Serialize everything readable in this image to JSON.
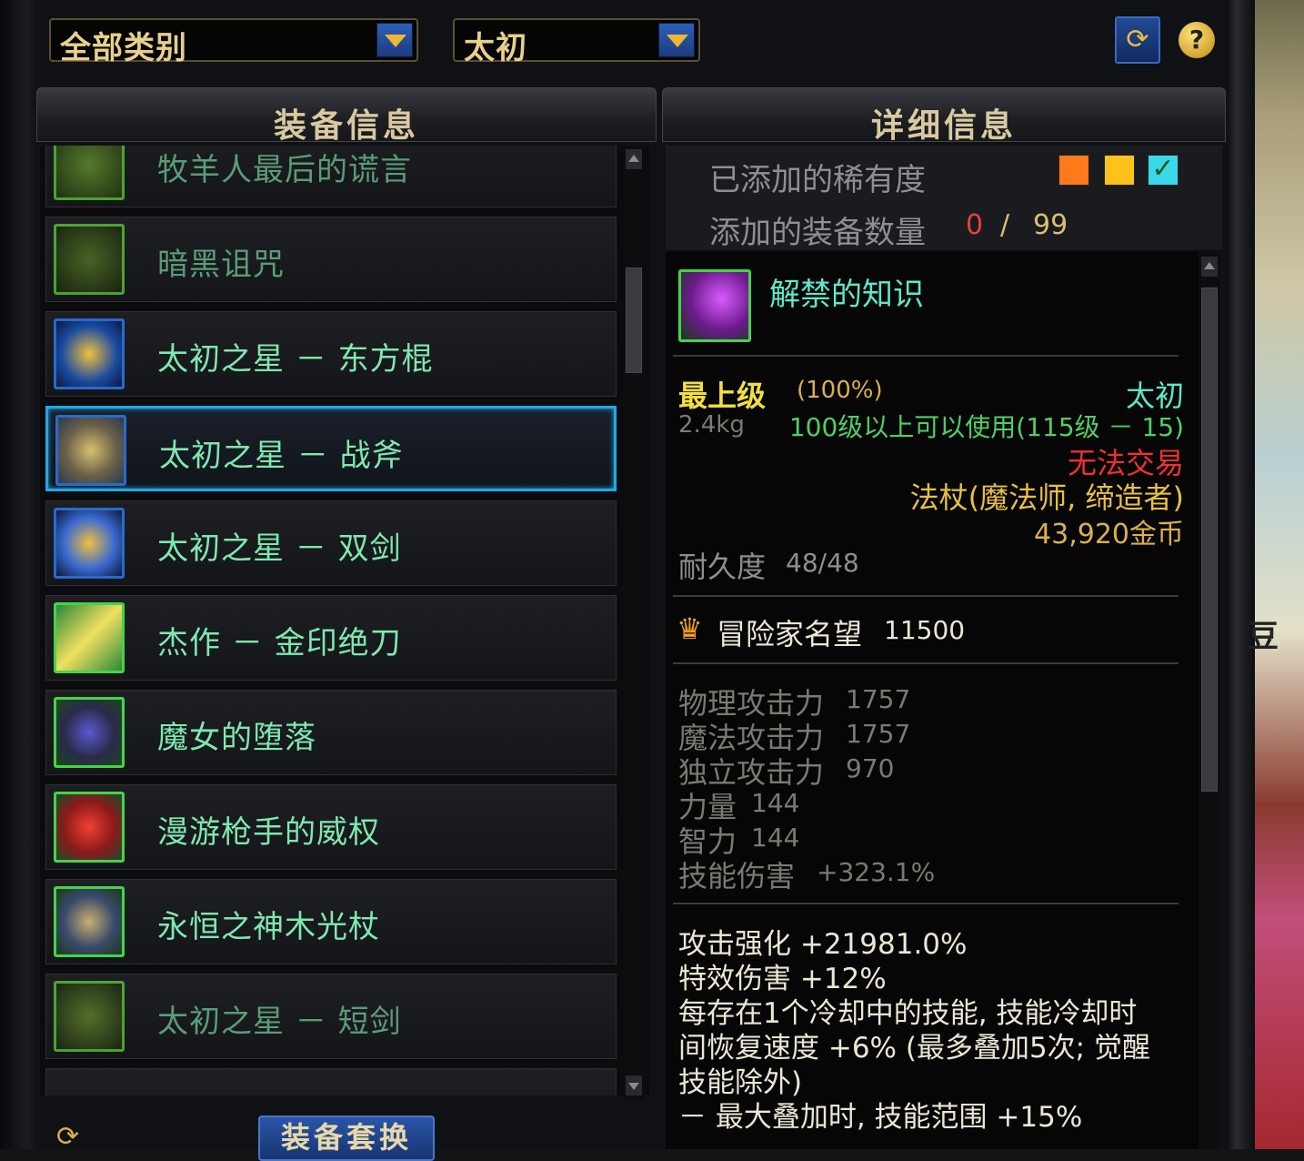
{
  "colors": {
    "selected_border": "#1fa9e8",
    "item_name": "#7ee8b0",
    "rarity_epic": "#f0e040",
    "untradeable": "#f03030"
  },
  "filters": {
    "category": "全部类别",
    "grade": "太初"
  },
  "toolbar": {
    "refresh_icon": "refresh-icon",
    "help_icon": "?"
  },
  "left_panel": {
    "title": "装备信息",
    "items": [
      {
        "name": "牧羊人最后的谎言",
        "icon": "shepherd-icon",
        "dim": true
      },
      {
        "name": "暗黑诅咒",
        "icon": "dark-curse-icon",
        "dim": true
      },
      {
        "name": "太初之星 － 东方棍",
        "icon": "staff-icon",
        "dim": false
      },
      {
        "name": "太初之星 － 战斧",
        "icon": "axe-icon",
        "dim": false,
        "selected": true
      },
      {
        "name": "太初之星 － 双剑",
        "icon": "twin-sword-icon",
        "dim": false
      },
      {
        "name": "杰作 － 金印绝刀",
        "icon": "golden-blade-icon",
        "dim": false
      },
      {
        "name": "魔女的堕落",
        "icon": "witch-icon",
        "dim": false
      },
      {
        "name": "漫游枪手的威权",
        "icon": "gunner-icon",
        "dim": false
      },
      {
        "name": "永恒之神木光杖",
        "icon": "light-staff-icon",
        "dim": false
      },
      {
        "name": "太初之星 － 短剑",
        "icon": "short-sword-icon",
        "dim": true
      }
    ],
    "swap_button": "装备套换"
  },
  "right_panel": {
    "title": "详细信息",
    "rarity_label": "已添加的稀有度",
    "rarity_colors": [
      "#ff7a1a",
      "#ffc21a",
      "#3ad8e8"
    ],
    "count_label": "添加的装备数量",
    "count_current": "0",
    "count_sep": "/",
    "count_max": "99",
    "item": {
      "name": "解禁的知识",
      "grade": "最上级",
      "grade_pct": "(100%)",
      "rarity": "太初",
      "weight": "2.4kg",
      "level_req": "100级以上可以使用(115级 － 15)",
      "trade": "无法交易",
      "type": "法杖(魔法师, 缔造者)",
      "price": "43,920金币",
      "durability_label": "耐久度",
      "durability": "48/48",
      "fame_label": "冒险家名望",
      "fame": "11500",
      "stats": [
        {
          "label": "物理攻击力",
          "value": "1757"
        },
        {
          "label": "魔法攻击力",
          "value": "1757"
        },
        {
          "label": "独立攻击力",
          "value": "970"
        },
        {
          "label": "力量",
          "value": "144"
        },
        {
          "label": "智力",
          "value": "144"
        },
        {
          "label": "技能伤害",
          "value": "+323.1%"
        }
      ],
      "effects": [
        "攻击强化 +21981.0%",
        "特效伤害 +12%",
        "每存在1个冷却中的技能, 技能冷却时",
        "间恢复速度 +6% (最多叠加5次; 觉醒",
        "技能除外)",
        "－ 最大叠加时, 技能范围 +15%"
      ]
    }
  },
  "scenery": {
    "text": "豆"
  }
}
